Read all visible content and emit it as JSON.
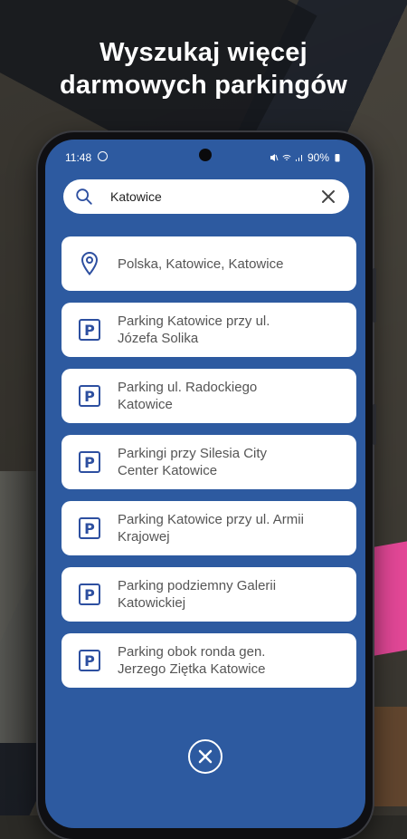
{
  "headline": {
    "line1": "Wyszukaj więcej",
    "line2": "darmowych parkingów"
  },
  "status_bar": {
    "time": "11:48",
    "battery": "90%"
  },
  "search": {
    "value": "Katowice",
    "icon": "search-icon",
    "clear_icon": "close-icon"
  },
  "results": [
    {
      "icon": "location-pin-icon",
      "line1": "Polska, Katowice, Katowice",
      "line2": ""
    },
    {
      "icon": "parking-icon",
      "line1": "Parking Katowice przy ul.",
      "line2": "Józefa Solika"
    },
    {
      "icon": "parking-icon",
      "line1": "Parking ul. Radockiego",
      "line2": "Katowice"
    },
    {
      "icon": "parking-icon",
      "line1": "Parkingi przy Silesia City",
      "line2": "Center Katowice"
    },
    {
      "icon": "parking-icon",
      "line1": "Parking Katowice przy ul. Armii",
      "line2": "Krajowej"
    },
    {
      "icon": "parking-icon",
      "line1": "Parking podziemny Galerii",
      "line2": "Katowickiej"
    },
    {
      "icon": "parking-icon",
      "line1": "Parking obok ronda gen.",
      "line2": "Jerzego Ziętka Katowice"
    }
  ],
  "colors": {
    "screen_bg": "#2d5aa0",
    "card_bg": "#ffffff",
    "parking_icon": "#2d4fa0"
  }
}
